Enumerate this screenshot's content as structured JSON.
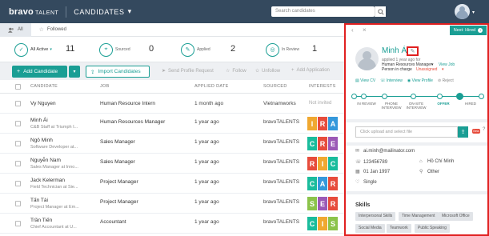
{
  "app": {
    "logo": "bravo",
    "logo_sub": "TALENT",
    "section": "CANDIDATES",
    "section_caret": "▾"
  },
  "search": {
    "placeholder": "Search candidates"
  },
  "filters": {
    "all": "All",
    "followed": "Followed"
  },
  "stats": [
    {
      "label": "All Active",
      "count": "11"
    },
    {
      "label": "Sourced",
      "count": "0"
    },
    {
      "label": "Applied",
      "count": "2"
    },
    {
      "label": "In Review",
      "count": "1"
    }
  ],
  "toolbar": {
    "add": "Add Candidate",
    "import": "Import Candidates",
    "send_profile": "Send Profile Request",
    "follow": "Follow",
    "unfollow": "Unfollow",
    "add_application": "Add Application"
  },
  "columns": [
    "CANDIDATE",
    "JOB",
    "APPLIED DATE",
    "SOURCED",
    "INTERESTS"
  ],
  "rows": [
    {
      "name": "Vy Nguyen",
      "sub": "",
      "job": "Human Resource Intern",
      "date": "1 month ago",
      "source": "Vietnamworks",
      "interests_text": "Not invited",
      "chips": []
    },
    {
      "name": "Minh Ái",
      "sub": "C&B Staff at Triumph I...",
      "job": "Human Resources Manager",
      "date": "1 year ago",
      "source": "bravoTALENTS",
      "interests_text": "",
      "chips": [
        {
          "l": "I",
          "c": "#f0a830"
        },
        {
          "l": "R",
          "c": "#e74c3c"
        },
        {
          "l": "A",
          "c": "#3498db"
        }
      ]
    },
    {
      "name": "Ngô Minh",
      "sub": "Software Developer at...",
      "job": "Sales Manager",
      "date": "1 year ago",
      "source": "bravoTALENTS",
      "interests_text": "",
      "chips": [
        {
          "l": "C",
          "c": "#1abc9c"
        },
        {
          "l": "R",
          "c": "#e74c3c"
        },
        {
          "l": "E",
          "c": "#9b59b6"
        }
      ]
    },
    {
      "name": "Nguyễn Nam",
      "sub": "Sales Manager at Inno...",
      "job": "Sales Manager",
      "date": "1 year ago",
      "source": "bravoTALENTS",
      "interests_text": "",
      "chips": [
        {
          "l": "R",
          "c": "#e74c3c"
        },
        {
          "l": "I",
          "c": "#f0a830"
        },
        {
          "l": "C",
          "c": "#1abc9c"
        }
      ]
    },
    {
      "name": "Jack Kelerman",
      "sub": "Field Technician at Sie...",
      "job": "Project Manager",
      "date": "1 year ago",
      "source": "bravoTALENTS",
      "interests_text": "",
      "chips": [
        {
          "l": "C",
          "c": "#1abc9c"
        },
        {
          "l": "A",
          "c": "#3498db"
        },
        {
          "l": "R",
          "c": "#e74c3c"
        }
      ]
    },
    {
      "name": "Tấn Tài",
      "sub": "Project Manager at Em...",
      "job": "Project Manager",
      "date": "1 year ago",
      "source": "bravoTALENTS",
      "interests_text": "",
      "chips": [
        {
          "l": "S",
          "c": "#8bc34a"
        },
        {
          "l": "E",
          "c": "#9b59b6"
        },
        {
          "l": "R",
          "c": "#e74c3c"
        }
      ]
    },
    {
      "name": "Trần Tiến",
      "sub": "Chief Accountant at U...",
      "job": "Accountant",
      "date": "1 year ago",
      "source": "bravoTALENTS",
      "interests_text": "",
      "chips": [
        {
          "l": "C",
          "c": "#1abc9c"
        },
        {
          "l": "I",
          "c": "#f0a830"
        },
        {
          "l": "S",
          "c": "#8bc34a"
        }
      ]
    }
  ],
  "panel": {
    "next": "Next: Hired",
    "name": "Minh Ái",
    "applied": "applied 1 year ago for",
    "job": "Human Resources Manager",
    "view_job": "View Job",
    "person_label": "Person in charge",
    "person_value": "Unassigned",
    "actions": [
      "View CV",
      "Interview",
      "View Profile",
      "Reject"
    ],
    "stages": [
      "IN REVIEW",
      "PHONE INTERVIEW",
      "ON-SITE INTERVIEW",
      "OFFER",
      "HIRED"
    ],
    "current_stage": "OFFER",
    "upload_placeholder": "Click upload and select file",
    "beta": "Beta",
    "email": "ai.minh@mailinator.com",
    "phone": "123456789",
    "city": "Hồ Chí Minh",
    "dob": "01 Jan 1997",
    "gender": "Other",
    "marital": "Single",
    "skills_title": "Skills",
    "skills": [
      "Interpersonal Skills",
      "Time Management",
      "Microsoft Office",
      "Social Media",
      "Teamwork",
      "Public Speaking"
    ]
  },
  "colors": {
    "accent": "#1a9e94",
    "topbar": "#34495e",
    "highlight": "#e02020"
  }
}
